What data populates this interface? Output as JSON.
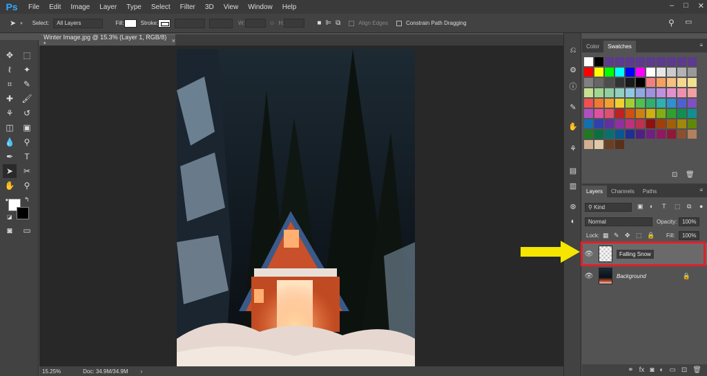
{
  "app": {
    "logo": "Ps"
  },
  "menu": [
    "File",
    "Edit",
    "Image",
    "Layer",
    "Type",
    "Select",
    "Filter",
    "3D",
    "View",
    "Window",
    "Help"
  ],
  "window_controls": [
    "–",
    "□",
    "✕"
  ],
  "options_bar": {
    "select_label": "Select:",
    "select_value": "All Layers",
    "fill_label": "Fill:",
    "stroke_label": "Stroke:",
    "w_label": "W:",
    "h_label": "H:",
    "align_edges": "Align Edges",
    "constrain": "Constrain Path Dragging"
  },
  "document": {
    "tab_title": "Winter Image.jpg @ 15.3% (Layer 1, RGB/8) *",
    "close": "×"
  },
  "status": {
    "zoom": "15.25%",
    "doc": "Doc: 34.9M/34.9M"
  },
  "color_panel": {
    "tabs": [
      "Color",
      "Swatches"
    ],
    "active_tab": "Swatches"
  },
  "swatches": [
    "#ffffff",
    "#000000",
    "#5c3a8c",
    "#5c3a8c",
    "#5c3a8c",
    "#5c3a8c",
    "#5c3a8c",
    "#5c3a8c",
    "#5c3a8c",
    "#5c3a8c",
    "#5c3a8c",
    "#ff0000",
    "#ffff00",
    "#00ff00",
    "#00ffff",
    "#0000ff",
    "#ff00ff",
    "#ffffff",
    "#e6e6e6",
    "#cccccc",
    "#b3b3b3",
    "#999999",
    "#808080",
    "#666666",
    "#4d4d4d",
    "#333333",
    "#1a1a1a",
    "#000000",
    "#f08080",
    "#f5a060",
    "#f7c080",
    "#f5d890",
    "#f0e090",
    "#c8e090",
    "#a0d890",
    "#90d0a0",
    "#90d0c0",
    "#90c8e0",
    "#90a8e0",
    "#a090e0",
    "#c090e0",
    "#e090d0",
    "#f090b0",
    "#f0a0a0",
    "#f05050",
    "#f07830",
    "#f0a030",
    "#f0d030",
    "#a0d030",
    "#50c050",
    "#30b070",
    "#30b0b0",
    "#3090d0",
    "#5060d0",
    "#8050c0",
    "#b050c0",
    "#e050a0",
    "#e05070",
    "#c02020",
    "#d05010",
    "#d08010",
    "#d0b010",
    "#80b010",
    "#30a030",
    "#109050",
    "#109090",
    "#1070b0",
    "#3040b0",
    "#6030a0",
    "#9030a0",
    "#c03080",
    "#c03050",
    "#901010",
    "#a04008",
    "#a06008",
    "#a08808",
    "#608808",
    "#207820",
    "#087040",
    "#087070",
    "#085890",
    "#203090",
    "#502080",
    "#702080",
    "#901860",
    "#901838",
    "#8a5030",
    "#b08060",
    "#d0b090",
    "#e0c8a8",
    "#6a4020",
    "#5a3018"
  ],
  "layers_panel": {
    "tabs": [
      "Layers",
      "Channels",
      "Paths"
    ],
    "active_tab": "Layers",
    "kind": "Kind",
    "blend_mode": "Normal",
    "opacity_label": "Opacity:",
    "opacity": "100%",
    "lock_label": "Lock:",
    "fill_label": "Fill:",
    "fill": "100%",
    "layers": [
      {
        "name": "Falling Snow",
        "selected": true
      },
      {
        "name": "Background",
        "selected": false
      }
    ]
  },
  "colors": {
    "highlight_box": "#e0202a",
    "arrow": "#f5e500",
    "selected_layer": "#6a6a6a"
  }
}
